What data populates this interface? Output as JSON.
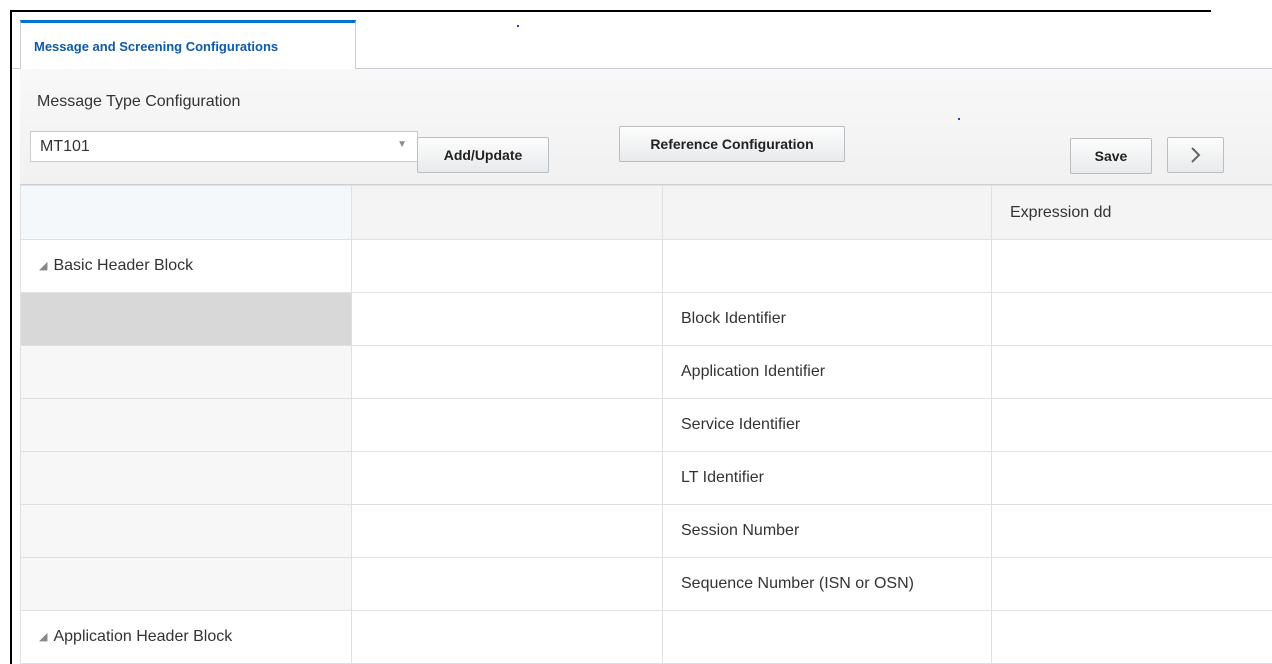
{
  "tabs": [
    {
      "label": "Message and Screening Configurations"
    }
  ],
  "config": {
    "title": "Message Type Configuration",
    "message_type_select": {
      "value": "MT101"
    },
    "add_update_label": "Add/Update",
    "reference_configuration_label": "Reference Configuration",
    "save_label": "Save",
    "next_icon": "chevron-right-icon"
  },
  "grid": {
    "headers": [
      "",
      "",
      "",
      "Expression dd"
    ],
    "rows": [
      {
        "block": "Basic Header Block",
        "field": "",
        "expression": ""
      },
      {
        "block": "",
        "field": "Block Identifier",
        "expression": ""
      },
      {
        "block": "",
        "field": "Application Identifier",
        "expression": ""
      },
      {
        "block": "",
        "field": "Service Identifier",
        "expression": ""
      },
      {
        "block": "",
        "field": "LT Identifier",
        "expression": ""
      },
      {
        "block": "",
        "field": "Session Number",
        "expression": ""
      },
      {
        "block": "",
        "field": "Sequence Number (ISN or OSN)",
        "expression": ""
      },
      {
        "block": "Application Header Block",
        "field": "",
        "expression": ""
      }
    ]
  },
  "colors": {
    "tab_accent": "#0572ce",
    "tab_text": "#0d5aa8",
    "selected_row": "#d8d8d8"
  }
}
